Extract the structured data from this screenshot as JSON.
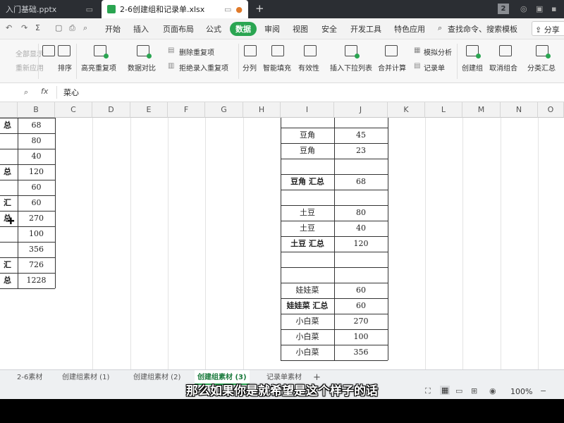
{
  "titlebar": {
    "tabs": [
      {
        "label": "入门基础.pptx",
        "active": false
      },
      {
        "label": "2-6创建组和记录单.xlsx",
        "active": true
      }
    ],
    "add_tab": "+",
    "badge": "2"
  },
  "menu": {
    "items": [
      "开始",
      "插入",
      "页面布局",
      "公式",
      "数据",
      "审阅",
      "视图",
      "安全",
      "开发工具",
      "特色应用"
    ],
    "active": "数据",
    "search": "查找命令、搜索模板",
    "share": "分享"
  },
  "ribbon": {
    "show_all": "全部显示",
    "reapply": "重新应用",
    "sort": "排序",
    "highlight_dup": "高亮重复项",
    "compare": "数据对比",
    "remove_dup": "删除重复项",
    "reject_dup": "拒绝录入重复项",
    "split": "分列",
    "smart_fill": "智能填充",
    "validity": "有效性",
    "dropdown": "插入下拉列表",
    "merge_calc": "合并计算",
    "simulate": "模拟分析",
    "record": "记录单",
    "create_group": "创建组",
    "ungroup": "取消组合",
    "subtotal": "分类汇总"
  },
  "formula": {
    "fx": "fx",
    "value": "菜心"
  },
  "columns": [
    "B",
    "C",
    "D",
    "E",
    "F",
    "G",
    "H",
    "I",
    "J",
    "K",
    "L",
    "M",
    "N",
    "O"
  ],
  "left_rows": [
    {
      "a": "总",
      "b": "68"
    },
    {
      "a": "",
      "b": "80"
    },
    {
      "a": "",
      "b": "40"
    },
    {
      "a": "总",
      "b": "120"
    },
    {
      "a": "",
      "b": "60"
    },
    {
      "a": "汇总",
      "b": "60"
    },
    {
      "a": "",
      "b": "270"
    },
    {
      "a": "",
      "b": "100"
    },
    {
      "a": "",
      "b": "356"
    },
    {
      "a": "汇总",
      "b": "726"
    },
    {
      "a": "",
      "b": "1228"
    }
  ],
  "right_rows": [
    {
      "i": "",
      "j": "",
      "bold": false
    },
    {
      "i": "豆角",
      "j": "45",
      "bold": false
    },
    {
      "i": "豆角",
      "j": "23",
      "bold": false
    },
    {
      "i": "",
      "j": "",
      "bold": false
    },
    {
      "i": "豆角 汇总",
      "j": "68",
      "bold": true
    },
    {
      "i": "",
      "j": "",
      "bold": false
    },
    {
      "i": "土豆",
      "j": "80",
      "bold": false
    },
    {
      "i": "土豆",
      "j": "40",
      "bold": false
    },
    {
      "i": "土豆 汇总",
      "j": "120",
      "bold": true
    },
    {
      "i": "",
      "j": "",
      "bold": false
    },
    {
      "i": "",
      "j": "",
      "bold": false
    },
    {
      "i": "娃娃菜",
      "j": "60",
      "bold": false
    },
    {
      "i": "娃娃菜 汇总",
      "j": "60",
      "bold": true
    },
    {
      "i": "小白菜",
      "j": "270",
      "bold": false
    },
    {
      "i": "小白菜",
      "j": "100",
      "bold": false
    },
    {
      "i": "小白菜",
      "j": "356",
      "bold": false
    }
  ],
  "sheets": [
    "2-6素材",
    "创建组素材 (1)",
    "创建组素材 (2)",
    "创建组素材 (3)",
    "记录单素材"
  ],
  "active_sheet": "创建组素材 (3)",
  "zoom": "100%",
  "subtitle": "那么如果你是就希望是这个样子的话",
  "colors": {
    "accent": "#2aa551"
  }
}
